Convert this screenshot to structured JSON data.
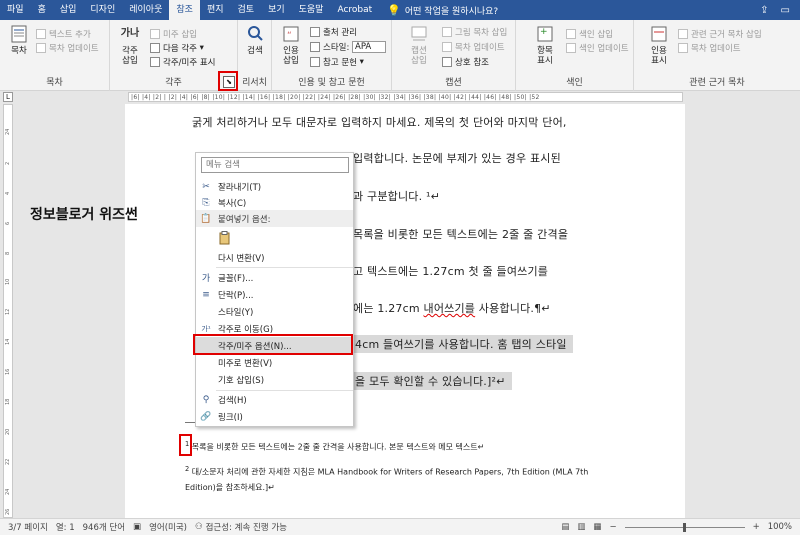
{
  "tabs": [
    "파일",
    "홈",
    "삽입",
    "디자인",
    "레이아웃",
    "참조",
    "편지",
    "검토",
    "보기",
    "도움말",
    "Acrobat"
  ],
  "active_tab": "참조",
  "tell_me": "어떤 작업을 원하시나요?",
  "ribbon": {
    "toc": {
      "big_label": "목차",
      "add_text": "텍스트 추가",
      "update_toc": "목차 업데이트",
      "group_label": "목차"
    },
    "footnotes": {
      "big_icon_text": "가나",
      "insert_footnote": "각주\n삽입",
      "insert_endnote": "미주 삽입",
      "next_footnote": "다음 각주",
      "show_notes": "각주/미주 표시",
      "group_label": "각주"
    },
    "research": {
      "search": "검색",
      "group_label": "리서치"
    },
    "citations": {
      "insert_citation": "인용\n삽입",
      "manage_sources": "출처 관리",
      "style_label": "스타일:",
      "style_value": "APA",
      "bibliography": "참고 문헌",
      "group_label": "인용 및 참고 문헌"
    },
    "captions": {
      "insert_caption": "캡션\n삽입",
      "insert_table_of_figures": "그림 목차 삽입",
      "update_table": "목차 업데이트",
      "cross_reference": "상호 참조",
      "group_label": "캡션"
    },
    "index": {
      "mark_entry": "항목\n표시",
      "insert_index": "색인 삽입",
      "update_index": "색인 업데이트",
      "group_label": "색인"
    },
    "authorities": {
      "mark_citation": "인용\n표시",
      "insert_toa": "관련 근거 목차 삽입",
      "update_toa": "목차 업데이트",
      "group_label": "관련 근거 목차"
    }
  },
  "ruler_text": "|6| |4| |2| | |2| |4| |6| |8| |10| |12| |14| |16| |18| |20| |22| |24| |26| |28| |30| |32| |34| |36| |38| |40| |42| |44| |46| |48| |50| |52",
  "vruler_ticks": [
    "24",
    "2",
    "4",
    "6",
    "8",
    "10",
    "12",
    "14",
    "16",
    "18",
    "20",
    "22",
    "24",
    "26"
  ],
  "watermark": "정보블로거 위즈썬",
  "document": {
    "line1": "굵게 처리하거나 모두 대문자로 입력하지 마세요. 제목의 첫 단어와 마지막 단어,",
    "line2": "입력합니다. 논문에 부제가 있는 경우 표시된",
    "line3": "과 구분합니다. ¹↵",
    "line4": "목록을 비롯한 모든 텍스트에는 2줄 줄 간격을",
    "line5": "고 텍스트에는 1.27cm 첫 줄 들여쓰기를",
    "line6a": "에는 1.27cm ",
    "line6b": "내어쓰기를",
    "line6c": " 사용합니다.¶↵",
    "line7": "4cm 들여쓰기를 사용합니다. 홈 탭의 스타일",
    "line8": "을 모두 확인할 수 있습니다.]²↵"
  },
  "footnotes": {
    "fn1_mark": "1",
    "fn1_text": "목록을 비롯한 모든 텍스트에는 2줄 줄 간격을 사용합니다. 본문 텍스트와 메모 텍스트↵",
    "fn2_mark": "2",
    "fn2_line1": "대/소문자 처리에 관한 자세한 지침은 MLA Handbook for Writers of Research Papers, 7th Edition (MLA 7th",
    "fn2_line2": "Edition)을 참조하세요.]↵"
  },
  "context_menu": {
    "search_placeholder": "메뉴 검색",
    "items": [
      {
        "icon": "✂",
        "label": "잘라내기(T)"
      },
      {
        "icon": "⎘",
        "label": "복사(C)"
      },
      {
        "icon": "📋",
        "label": "붙여넣기 옵션:"
      },
      {
        "icon": "",
        "label": "다시 변환(V)"
      },
      {
        "icon": "가",
        "label": "글꼴(F)..."
      },
      {
        "icon": "≡",
        "label": "단락(P)..."
      },
      {
        "icon": "",
        "label": "스타일(Y)"
      },
      {
        "icon": "가¹",
        "label": "각주로 이동(G)"
      },
      {
        "icon": "",
        "label": "각주/미주 옵션(N)..."
      },
      {
        "icon": "",
        "label": "미주로 변환(V)"
      },
      {
        "icon": "",
        "label": "기호 삽입(S)"
      },
      {
        "icon": "⚲",
        "label": "검색(H)"
      },
      {
        "icon": "🔗",
        "label": "링크(I)"
      }
    ]
  },
  "status": {
    "page": "3/7 페이지",
    "column": "열: 1",
    "words": "946개 단어",
    "language": "영어(미국)",
    "accessibility": "접근성: 계속 진행 가능",
    "zoom": "100%"
  },
  "colors": {
    "titlebar": "#2b579a",
    "highlight_box": "#e00000"
  }
}
